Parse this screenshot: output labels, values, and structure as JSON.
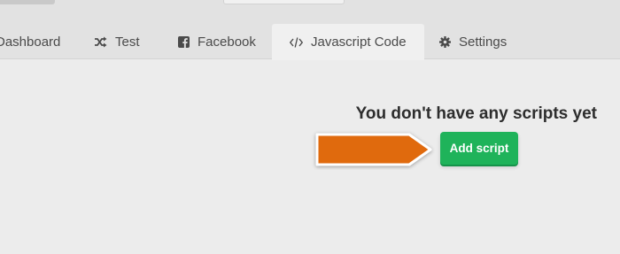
{
  "tabs": [
    {
      "label": "Dashboard",
      "icon": "none"
    },
    {
      "label": "Test",
      "icon": "shuffle-icon"
    },
    {
      "label": "Facebook",
      "icon": "facebook-icon"
    },
    {
      "label": "Javascript Code",
      "icon": "code-icon",
      "active": true
    },
    {
      "label": "Settings",
      "icon": "gear-icon"
    }
  ],
  "empty_state": {
    "heading": "You don't have any scripts yet",
    "button_label": "Add script"
  },
  "colors": {
    "background": "#ececec",
    "tab_bar": "#e2e2e2",
    "active_tab": "#f0f0f0",
    "button": "#1fb35a",
    "arrow": "#e06a0f",
    "text": "#4b4b4b"
  }
}
